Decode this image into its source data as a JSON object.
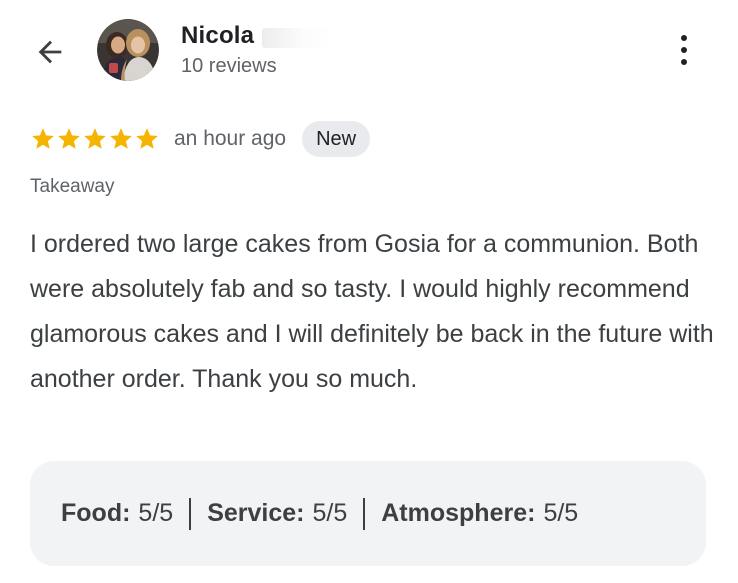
{
  "reviewer": {
    "name": "Nicola",
    "review_count": "10 reviews"
  },
  "icons": {
    "back": "arrow-back-icon",
    "more": "more-vert-icon",
    "star": "star-icon"
  },
  "review": {
    "rating": 5,
    "max_rating": 5,
    "time_ago": "an hour ago",
    "badge": "New",
    "service_type": "Takeaway",
    "text": "I ordered two large cakes from Gosia for a communion. Both were absolutely fab and so tasty. I would highly recommend glamorous cakes and I will definitely be back in the future with another order. Thank you so much."
  },
  "ratings": {
    "food_label": "Food:",
    "food_value": "5/5",
    "service_label": "Service:",
    "service_value": "5/5",
    "atmosphere_label": "Atmosphere:",
    "atmosphere_value": "5/5"
  },
  "colors": {
    "star": "#f4b400",
    "badge_bg": "#e8eaed",
    "panel_bg": "#f1f3f4",
    "secondary_text": "#5f6368"
  }
}
